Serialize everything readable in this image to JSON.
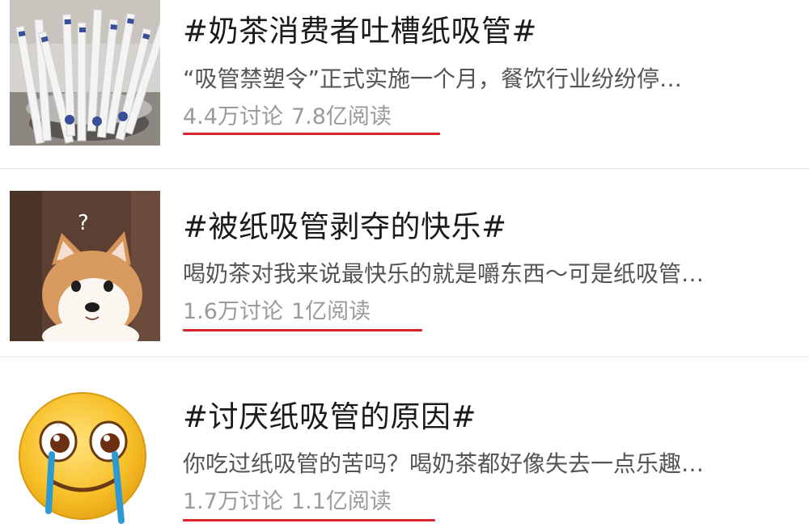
{
  "topics": [
    {
      "title": "#奶茶消费者吐槽纸吸管#",
      "description": "“吸管禁塑令”正式实施一个月，餐饮行业纷纷停…",
      "discussions": "4.4万讨论",
      "reads": "7.8亿阅读",
      "thumbnail_icon": "paper-straws-photo"
    },
    {
      "title": "#被纸吸管剥夺的快乐#",
      "description": "喝奶茶对我来说最快乐的就是嚼东西～可是纸吸管…",
      "discussions": "1.6万讨论",
      "reads": "1亿阅读",
      "thumbnail_icon": "confused-shiba-dog-photo"
    },
    {
      "title": "#讨厌纸吸管的原因#",
      "description": "你吃过纸吸管的苦吗？喝奶茶都好像失去一点乐趣…",
      "discussions": "1.7万讨论",
      "reads": "1.1亿阅读",
      "thumbnail_icon": "crying-smiley-emoji"
    }
  ],
  "colors": {
    "title": "#1b1b1b",
    "description": "#555555",
    "stats": "#9a9a9a",
    "underline": "#d8262c",
    "divider": "#e4e4e4"
  }
}
